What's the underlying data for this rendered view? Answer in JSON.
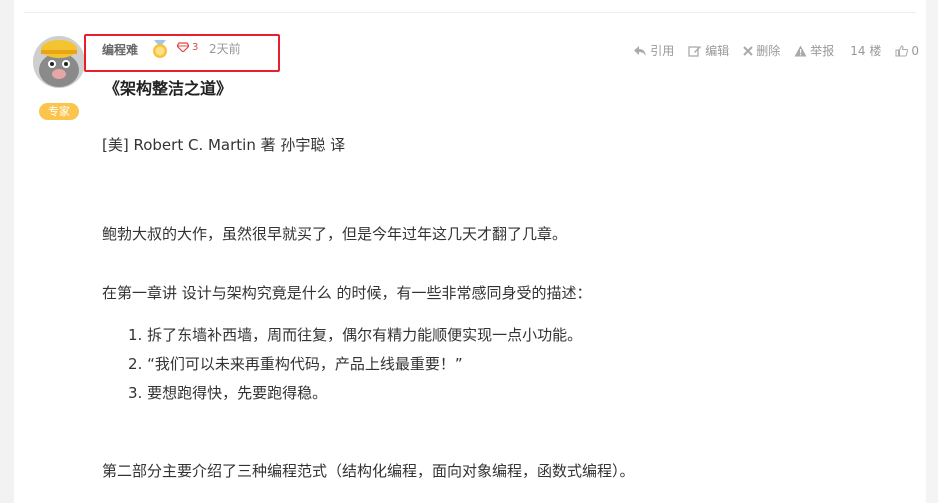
{
  "author": {
    "name": "编程难",
    "badge": "专家",
    "gem_count": "3",
    "time": "2天前"
  },
  "actions": {
    "quote": "引用",
    "edit": "编辑",
    "delete": "删除",
    "report": "举报",
    "floor": "14 楼",
    "likes": "0"
  },
  "post": {
    "title": "《架构整洁之道》",
    "byline": "[美] Robert C. Martin 著    孙宇聪 译",
    "p1": "鲍勃大叔的大作，虽然很早就买了，但是今年过年这几天才翻了几章。",
    "p2": "在第一章讲 设计与架构究竟是什么 的时候，有一些非常感同身受的描述：",
    "list": [
      "1. 拆了东墙补西墙，周而往复，偶尔有精力能顺便实现一点小功能。",
      "2. “我们可以未来再重构代码，产品上线最重要！”",
      "3.  要想跑得快，先要跑得稳。"
    ],
    "p3": "第二部分主要介绍了三种编程范式（结构化编程，面向对象编程，函数式编程）。"
  },
  "colors": {
    "highlight_border": "#e8202b",
    "badge_bg": "#fbc54d",
    "gem": "#e04848"
  }
}
